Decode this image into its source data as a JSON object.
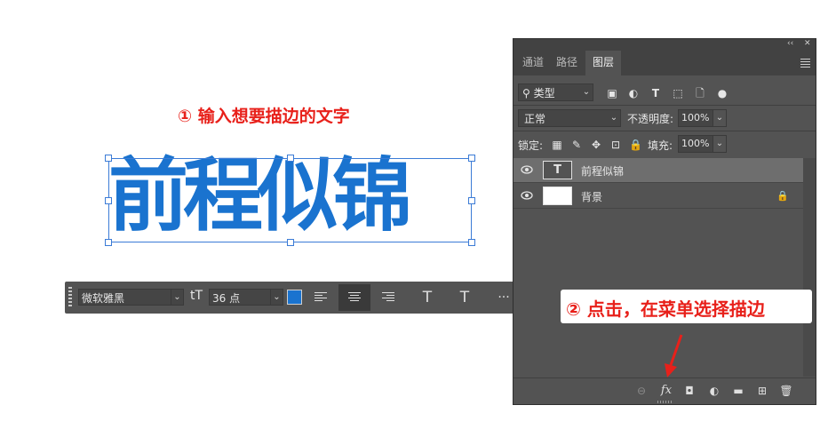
{
  "annotations": {
    "step1": "① 输入想要描边的文字",
    "step2": "② 点击，在菜单选择描边"
  },
  "canvas": {
    "text": "前程似锦",
    "text_color": "#1a73cf"
  },
  "text_options_bar": {
    "font_family": "微软雅黑",
    "size_icon": "tT",
    "font_size": "36 点",
    "color": "#1a73cf",
    "align_left_icon": "align-left-icon",
    "align_center_icon": "align-center-icon",
    "align_right_icon": "align-right-icon",
    "warp_icon": "T",
    "panel_icon": "T",
    "more": "···"
  },
  "layers_panel": {
    "collapse": "‹‹",
    "close": "✕",
    "tabs": [
      {
        "label": "通道",
        "active": false
      },
      {
        "label": "路径",
        "active": false
      },
      {
        "label": "图层",
        "active": true
      }
    ],
    "filter": {
      "icon": "search-icon",
      "label": "类型"
    },
    "blend_mode": "正常",
    "opacity_label": "不透明度:",
    "opacity_value": "100%",
    "lock_label": "锁定:",
    "fill_label": "填充:",
    "fill_value": "100%",
    "layers": [
      {
        "name": "前程似锦",
        "type": "text",
        "thumb_text": "T",
        "selected": true,
        "visible": true,
        "locked": false
      },
      {
        "name": "背景",
        "type": "background",
        "selected": false,
        "visible": true,
        "locked": true
      }
    ],
    "bottom": {
      "link": "🔗",
      "fx": "fx",
      "mask": "◘",
      "adjustment": "◐",
      "group": "▬",
      "new_layer": "+",
      "delete": "🗑"
    }
  }
}
